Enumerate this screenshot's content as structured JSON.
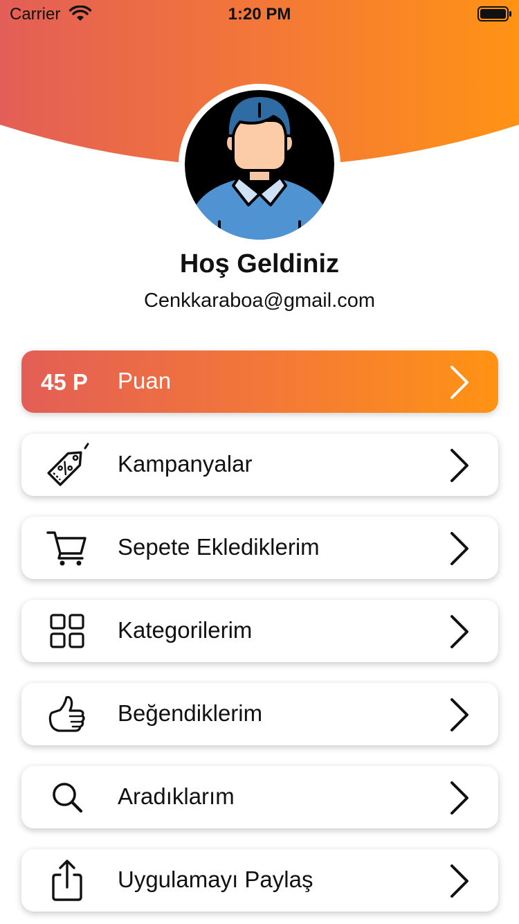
{
  "status_bar": {
    "carrier": "Carrier",
    "time": "1:20 PM"
  },
  "header": {
    "gradient_start": "#e35e56",
    "gradient_end": "#ff9314"
  },
  "profile": {
    "avatar_icon": "user-avatar-icon",
    "welcome": "Hoş Geldiniz",
    "email": "Cenkkaraboa@gmail.com"
  },
  "points": {
    "value": "45 P",
    "label": "Puan"
  },
  "menu": [
    {
      "label": "Kampanyalar",
      "icon": "discount-tag-icon"
    },
    {
      "label": "Sepete Eklediklerim",
      "icon": "cart-icon"
    },
    {
      "label": "Kategorilerim",
      "icon": "grid-icon"
    },
    {
      "label": "Beğendiklerim",
      "icon": "thumbs-up-icon"
    },
    {
      "label": "Aradıklarım",
      "icon": "search-icon"
    },
    {
      "label": "Uygulamayı Paylaş",
      "icon": "share-icon"
    }
  ]
}
